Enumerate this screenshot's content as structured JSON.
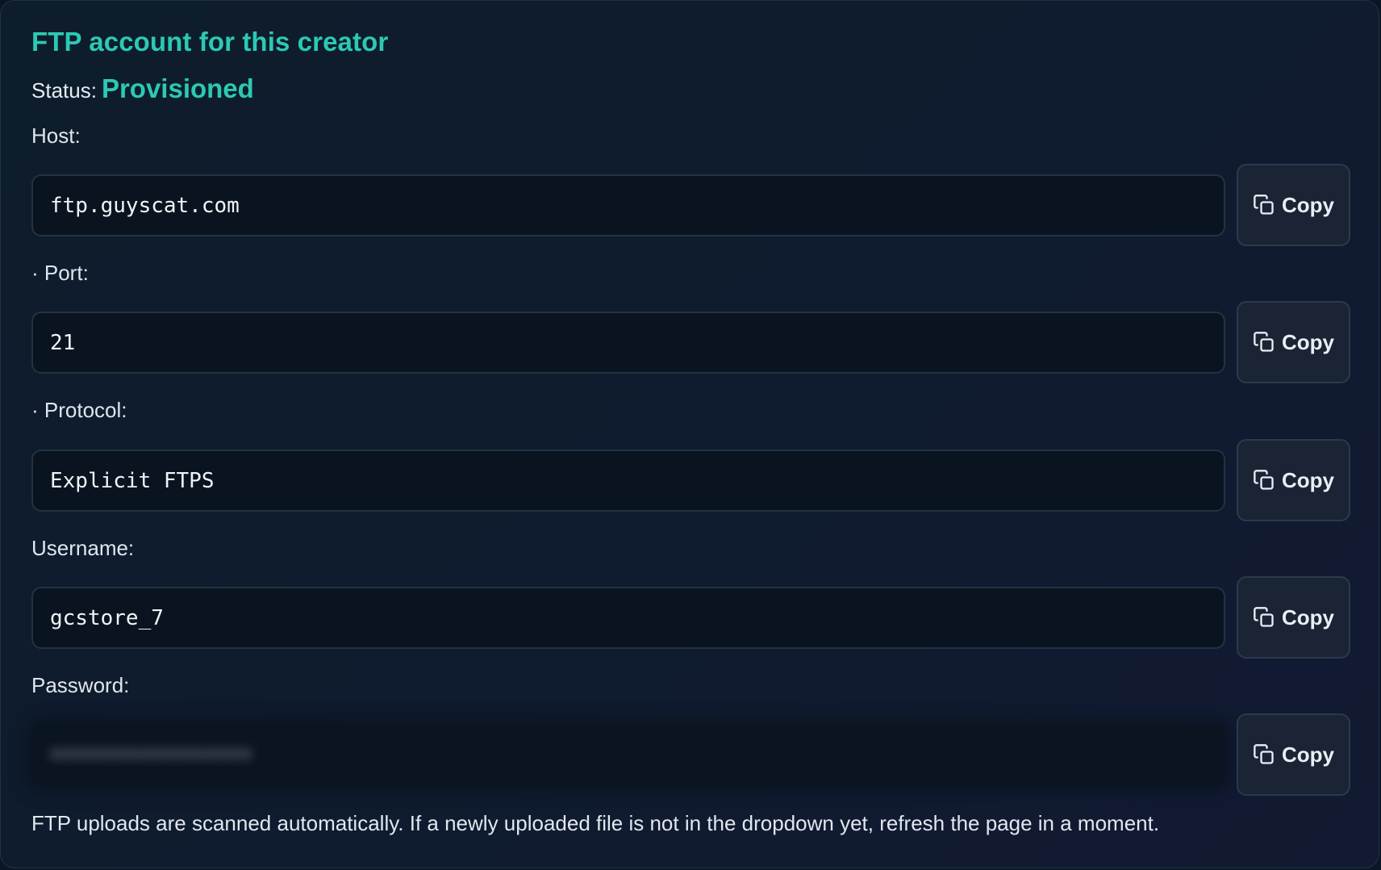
{
  "card": {
    "title": "FTP account for this creator",
    "status_label": "Status:",
    "status_value": "Provisioned"
  },
  "fields": {
    "host": {
      "label": "Host:",
      "value": "ftp.guyscat.com"
    },
    "port": {
      "label": "· Port:",
      "value": "21"
    },
    "protocol": {
      "label": "· Protocol:",
      "value": "Explicit FTPS"
    },
    "username": {
      "label": "Username:",
      "value": "gcstore_7"
    },
    "password": {
      "label": "Password:",
      "value": "••••••••••••••••"
    }
  },
  "buttons": {
    "copy_label": "Copy",
    "copy_icon": "copy-icon"
  },
  "footer": {
    "note": "FTP uploads are scanned automatically. If a newly uploaded file is not in the dropdown yet, refresh the page in a moment."
  },
  "colors": {
    "accent": "#2cc9b4",
    "background": "#0e1d2c",
    "field_bg": "#0a1421",
    "button_bg": "#1a2434"
  }
}
